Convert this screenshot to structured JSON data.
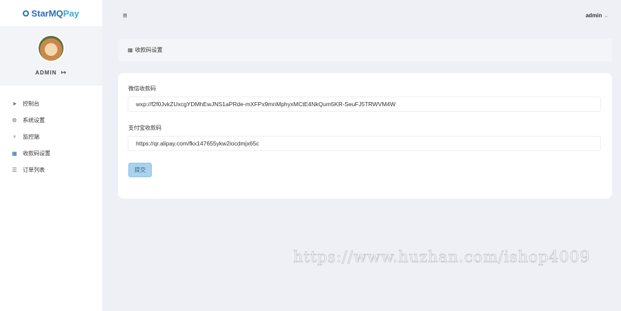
{
  "brand": {
    "part1": "StarMQ",
    "part2": "Pay",
    "accent": "#2a6fb3",
    "accent2": "#38a9d8"
  },
  "profile": {
    "name": "ADMIN"
  },
  "sidebar": {
    "items": [
      {
        "label": "控制台",
        "icon": "rocket-icon",
        "active": false
      },
      {
        "label": "系统设置",
        "icon": "gear-icon",
        "active": false
      },
      {
        "label": "监控端",
        "icon": "bolt-icon",
        "active": false
      },
      {
        "label": "收款码设置",
        "icon": "grid-icon",
        "active": true
      },
      {
        "label": "订单列表",
        "icon": "list-icon",
        "active": false
      }
    ]
  },
  "topbar": {
    "user": "admin"
  },
  "page": {
    "title": "收款码设置"
  },
  "form": {
    "wechat_label": "微信收款码",
    "wechat_value": "wxp://f2f0JvkZUxcgYDMhEwJNS1aPRde-mXFPx9mnMphyxMCtE4NkQum5KR-SeuFJ5TRWVM4W",
    "alipay_label": "支付宝收款码",
    "alipay_value": "https://qr.alipay.com/fkx147655ykw2iocdmjx65c",
    "submit_label": "提交"
  },
  "watermark": "https://www.huzhan.com/ishop4009"
}
